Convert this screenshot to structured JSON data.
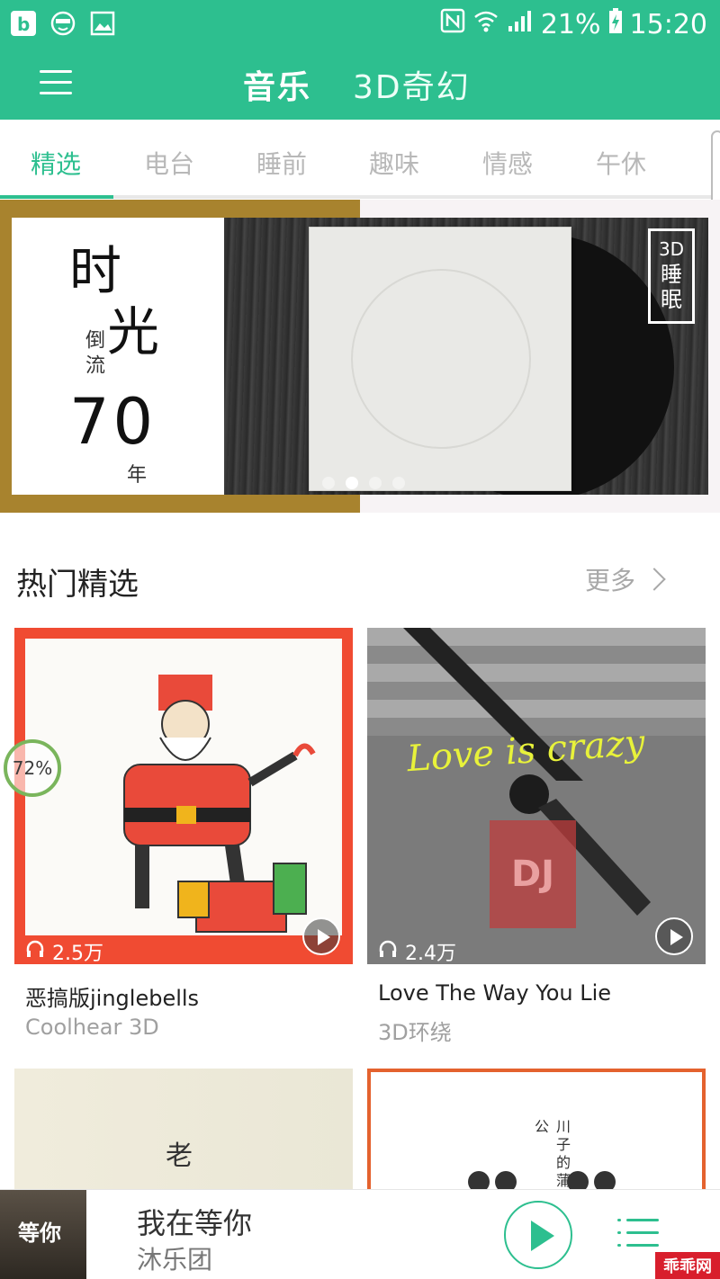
{
  "status_bar": {
    "battery": "21%",
    "time": "15:20",
    "icons_left": [
      "app-b-icon",
      "face-icon",
      "gallery-icon"
    ],
    "icons_right": [
      "nfc-icon",
      "wifi-icon",
      "signal-icon",
      "battery-charging-icon"
    ]
  },
  "header": {
    "tabs": [
      {
        "label": "音乐",
        "active": true
      },
      {
        "label": "3D奇幻",
        "active": false
      }
    ]
  },
  "category_tabs": [
    "精选",
    "电台",
    "睡前",
    "趣味",
    "情感",
    "午休"
  ],
  "active_category": "精选",
  "banner": {
    "line1": "时",
    "line2": "光",
    "line3": "倒流",
    "line4": "70",
    "line5": "年",
    "badge_top": "3D",
    "badge_mid": "睡",
    "badge_bot": "眠",
    "page_count": 4,
    "active_page": 2
  },
  "section": {
    "title": "热门精选",
    "more": "更多"
  },
  "cards": [
    {
      "title": "恶搞版jinglebells",
      "subtitle": "Coolhear 3D",
      "plays": "2.5万"
    },
    {
      "title": "Love The Way You Lie",
      "subtitle": "3D环绕",
      "plays": "2.4万",
      "art_text": "Love is crazy"
    },
    {
      "title": "",
      "subtitle": "",
      "art_char": "老"
    },
    {
      "title": "",
      "subtitle": "",
      "art_text": "川子的蒲公"
    }
  ],
  "float_badge": "72%",
  "player": {
    "title": "我在等你",
    "artist": "沐乐团",
    "cover_big": "等你"
  },
  "watermark": "乖乖网",
  "colors": {
    "accent": "#2dbf8f",
    "banner_gold": "#a8832e",
    "card_red": "#f04b32"
  }
}
